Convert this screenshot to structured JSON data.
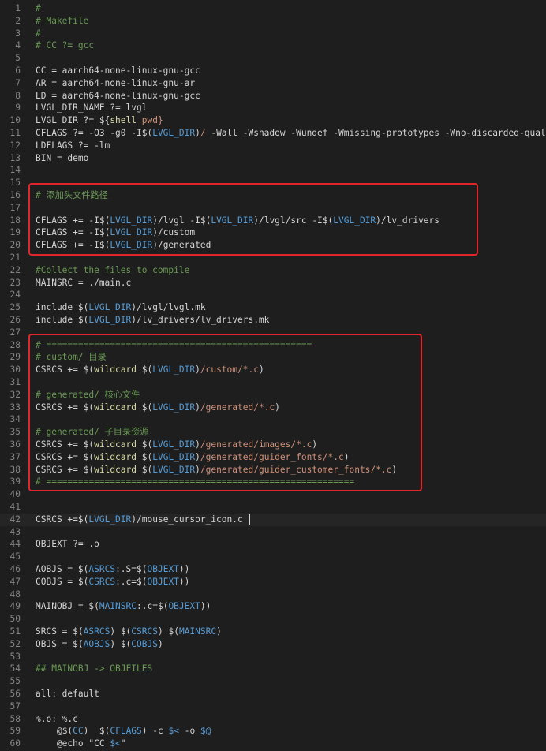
{
  "lines": [
    {
      "n": "1",
      "tokens": [
        {
          "t": "#",
          "c": "comment"
        }
      ]
    },
    {
      "n": "2",
      "tokens": [
        {
          "t": "# Makefile",
          "c": "comment"
        }
      ]
    },
    {
      "n": "3",
      "tokens": [
        {
          "t": "#",
          "c": "comment"
        }
      ]
    },
    {
      "n": "4",
      "tokens": [
        {
          "t": "# CC ?= gcc",
          "c": "comment"
        }
      ]
    },
    {
      "n": "5",
      "tokens": []
    },
    {
      "n": "6",
      "tokens": [
        {
          "t": "CC = aarch64-none-linux-gnu-gcc",
          "c": "plain"
        }
      ]
    },
    {
      "n": "7",
      "tokens": [
        {
          "t": "AR = aarch64-none-linux-gnu-ar",
          "c": "plain"
        }
      ]
    },
    {
      "n": "8",
      "tokens": [
        {
          "t": "LD = aarch64-none-linux-gnu-gcc",
          "c": "plain"
        }
      ]
    },
    {
      "n": "9",
      "tokens": [
        {
          "t": "LVGL_DIR_NAME ?= lvgl",
          "c": "plain"
        }
      ]
    },
    {
      "n": "10",
      "tokens": [
        {
          "t": "LVGL_DIR ?= ",
          "c": "plain"
        },
        {
          "t": "${",
          "c": "op"
        },
        {
          "t": "shell",
          "c": "fn"
        },
        {
          "t": " pwd}",
          "c": "str"
        }
      ]
    },
    {
      "n": "11",
      "tokens": [
        {
          "t": "CFLAGS ?= -O3 -g0 -I",
          "c": "plain"
        },
        {
          "t": "$(",
          "c": "op"
        },
        {
          "t": "LVGL_DIR",
          "c": "var"
        },
        {
          "t": ")",
          "c": "op"
        },
        {
          "t": "/",
          "c": "str"
        },
        {
          "t": " -Wall -Wshadow -Wundef -Wmissing-prototypes -Wno-discarded-qualifiers",
          "c": "plain"
        }
      ]
    },
    {
      "n": "12",
      "tokens": [
        {
          "t": "LDFLAGS ?= -lm",
          "c": "plain"
        }
      ]
    },
    {
      "n": "13",
      "tokens": [
        {
          "t": "BIN = demo",
          "c": "plain"
        }
      ]
    },
    {
      "n": "14",
      "tokens": []
    },
    {
      "n": "15",
      "tokens": []
    },
    {
      "n": "16",
      "tokens": [
        {
          "t": "# 添加头文件路径",
          "c": "comment"
        }
      ]
    },
    {
      "n": "17",
      "tokens": []
    },
    {
      "n": "18",
      "tokens": [
        {
          "t": "CFLAGS += -I",
          "c": "plain"
        },
        {
          "t": "$(",
          "c": "op"
        },
        {
          "t": "LVGL_DIR",
          "c": "var"
        },
        {
          "t": ")",
          "c": "op"
        },
        {
          "t": "/lvgl -I",
          "c": "plain"
        },
        {
          "t": "$(",
          "c": "op"
        },
        {
          "t": "LVGL_DIR",
          "c": "var"
        },
        {
          "t": ")",
          "c": "op"
        },
        {
          "t": "/lvgl/src -I",
          "c": "plain"
        },
        {
          "t": "$(",
          "c": "op"
        },
        {
          "t": "LVGL_DIR",
          "c": "var"
        },
        {
          "t": ")",
          "c": "op"
        },
        {
          "t": "/lv_drivers",
          "c": "plain"
        }
      ]
    },
    {
      "n": "19",
      "tokens": [
        {
          "t": "CFLAGS += -I",
          "c": "plain"
        },
        {
          "t": "$(",
          "c": "op"
        },
        {
          "t": "LVGL_DIR",
          "c": "var"
        },
        {
          "t": ")",
          "c": "op"
        },
        {
          "t": "/custom",
          "c": "plain"
        }
      ]
    },
    {
      "n": "20",
      "tokens": [
        {
          "t": "CFLAGS += -I",
          "c": "plain"
        },
        {
          "t": "$(",
          "c": "op"
        },
        {
          "t": "LVGL_DIR",
          "c": "var"
        },
        {
          "t": ")",
          "c": "op"
        },
        {
          "t": "/generated",
          "c": "plain"
        }
      ]
    },
    {
      "n": "21",
      "tokens": []
    },
    {
      "n": "22",
      "tokens": [
        {
          "t": "#Collect the files to compile",
          "c": "comment"
        }
      ]
    },
    {
      "n": "23",
      "tokens": [
        {
          "t": "MAINSRC = ./main.c",
          "c": "plain"
        }
      ]
    },
    {
      "n": "24",
      "tokens": []
    },
    {
      "n": "25",
      "tokens": [
        {
          "t": "include ",
          "c": "plain"
        },
        {
          "t": "$(",
          "c": "op"
        },
        {
          "t": "LVGL_DIR",
          "c": "var"
        },
        {
          "t": ")",
          "c": "op"
        },
        {
          "t": "/lvgl/lvgl.mk",
          "c": "plain"
        }
      ]
    },
    {
      "n": "26",
      "tokens": [
        {
          "t": "include ",
          "c": "plain"
        },
        {
          "t": "$(",
          "c": "op"
        },
        {
          "t": "LVGL_DIR",
          "c": "var"
        },
        {
          "t": ")",
          "c": "op"
        },
        {
          "t": "/lv_drivers/lv_drivers.mk",
          "c": "plain"
        }
      ]
    },
    {
      "n": "27",
      "tokens": []
    },
    {
      "n": "28",
      "tokens": [
        {
          "t": "# ==================================================",
          "c": "comment"
        }
      ]
    },
    {
      "n": "29",
      "tokens": [
        {
          "t": "# custom/ 目录",
          "c": "comment"
        }
      ]
    },
    {
      "n": "30",
      "tokens": [
        {
          "t": "CSRCS += ",
          "c": "plain"
        },
        {
          "t": "$(",
          "c": "op"
        },
        {
          "t": "wildcard",
          "c": "fn"
        },
        {
          "t": " ",
          "c": "plain"
        },
        {
          "t": "$(",
          "c": "op"
        },
        {
          "t": "LVGL_DIR",
          "c": "var"
        },
        {
          "t": ")",
          "c": "op"
        },
        {
          "t": "/custom/*.c",
          "c": "str"
        },
        {
          "t": ")",
          "c": "op"
        }
      ]
    },
    {
      "n": "31",
      "tokens": []
    },
    {
      "n": "32",
      "tokens": [
        {
          "t": "# generated/ 核心文件",
          "c": "comment"
        }
      ]
    },
    {
      "n": "33",
      "tokens": [
        {
          "t": "CSRCS += ",
          "c": "plain"
        },
        {
          "t": "$(",
          "c": "op"
        },
        {
          "t": "wildcard",
          "c": "fn"
        },
        {
          "t": " ",
          "c": "plain"
        },
        {
          "t": "$(",
          "c": "op"
        },
        {
          "t": "LVGL_DIR",
          "c": "var"
        },
        {
          "t": ")",
          "c": "op"
        },
        {
          "t": "/generated/*.c",
          "c": "str"
        },
        {
          "t": ")",
          "c": "op"
        }
      ]
    },
    {
      "n": "34",
      "tokens": []
    },
    {
      "n": "35",
      "tokens": [
        {
          "t": "# generated/ 子目录资源",
          "c": "comment"
        }
      ]
    },
    {
      "n": "36",
      "tokens": [
        {
          "t": "CSRCS += ",
          "c": "plain"
        },
        {
          "t": "$(",
          "c": "op"
        },
        {
          "t": "wildcard",
          "c": "fn"
        },
        {
          "t": " ",
          "c": "plain"
        },
        {
          "t": "$(",
          "c": "op"
        },
        {
          "t": "LVGL_DIR",
          "c": "var"
        },
        {
          "t": ")",
          "c": "op"
        },
        {
          "t": "/generated/images/*.c",
          "c": "str"
        },
        {
          "t": ")",
          "c": "op"
        }
      ]
    },
    {
      "n": "37",
      "tokens": [
        {
          "t": "CSRCS += ",
          "c": "plain"
        },
        {
          "t": "$(",
          "c": "op"
        },
        {
          "t": "wildcard",
          "c": "fn"
        },
        {
          "t": " ",
          "c": "plain"
        },
        {
          "t": "$(",
          "c": "op"
        },
        {
          "t": "LVGL_DIR",
          "c": "var"
        },
        {
          "t": ")",
          "c": "op"
        },
        {
          "t": "/generated/guider_fonts/*.c",
          "c": "str"
        },
        {
          "t": ")",
          "c": "op"
        }
      ]
    },
    {
      "n": "38",
      "tokens": [
        {
          "t": "CSRCS += ",
          "c": "plain"
        },
        {
          "t": "$(",
          "c": "op"
        },
        {
          "t": "wildcard",
          "c": "fn"
        },
        {
          "t": " ",
          "c": "plain"
        },
        {
          "t": "$(",
          "c": "op"
        },
        {
          "t": "LVGL_DIR",
          "c": "var"
        },
        {
          "t": ")",
          "c": "op"
        },
        {
          "t": "/generated/guider_customer_fonts/*.c",
          "c": "str"
        },
        {
          "t": ")",
          "c": "op"
        }
      ]
    },
    {
      "n": "39",
      "tokens": [
        {
          "t": "# ==========================================================",
          "c": "comment"
        }
      ]
    },
    {
      "n": "40",
      "tokens": []
    },
    {
      "n": "41",
      "tokens": []
    },
    {
      "n": "42",
      "tokens": [
        {
          "t": "CSRCS +=",
          "c": "plain"
        },
        {
          "t": "$(",
          "c": "op"
        },
        {
          "t": "LVGL_DIR",
          "c": "var"
        },
        {
          "t": ")",
          "c": "op"
        },
        {
          "t": "/mouse_cursor_icon.c ",
          "c": "plain"
        }
      ],
      "caret": true,
      "current": true
    },
    {
      "n": "43",
      "tokens": []
    },
    {
      "n": "44",
      "tokens": [
        {
          "t": "OBJEXT ?= .o",
          "c": "plain"
        }
      ]
    },
    {
      "n": "45",
      "tokens": []
    },
    {
      "n": "46",
      "tokens": [
        {
          "t": "AOBJS = ",
          "c": "plain"
        },
        {
          "t": "$(",
          "c": "op"
        },
        {
          "t": "ASRCS",
          "c": "var"
        },
        {
          "t": ":.S=",
          "c": "plain"
        },
        {
          "t": "$(",
          "c": "op"
        },
        {
          "t": "OBJEXT",
          "c": "var"
        },
        {
          "t": "))",
          "c": "op"
        }
      ]
    },
    {
      "n": "47",
      "tokens": [
        {
          "t": "COBJS = ",
          "c": "plain"
        },
        {
          "t": "$(",
          "c": "op"
        },
        {
          "t": "CSRCS",
          "c": "var"
        },
        {
          "t": ":.c=",
          "c": "plain"
        },
        {
          "t": "$(",
          "c": "op"
        },
        {
          "t": "OBJEXT",
          "c": "var"
        },
        {
          "t": "))",
          "c": "op"
        }
      ]
    },
    {
      "n": "48",
      "tokens": []
    },
    {
      "n": "49",
      "tokens": [
        {
          "t": "MAINOBJ = ",
          "c": "plain"
        },
        {
          "t": "$(",
          "c": "op"
        },
        {
          "t": "MAINSRC",
          "c": "var"
        },
        {
          "t": ":.c=",
          "c": "plain"
        },
        {
          "t": "$(",
          "c": "op"
        },
        {
          "t": "OBJEXT",
          "c": "var"
        },
        {
          "t": "))",
          "c": "op"
        }
      ]
    },
    {
      "n": "50",
      "tokens": []
    },
    {
      "n": "51",
      "tokens": [
        {
          "t": "SRCS = ",
          "c": "plain"
        },
        {
          "t": "$(",
          "c": "op"
        },
        {
          "t": "ASRCS",
          "c": "var"
        },
        {
          "t": ") ",
          "c": "op"
        },
        {
          "t": "$(",
          "c": "op"
        },
        {
          "t": "CSRCS",
          "c": "var"
        },
        {
          "t": ") ",
          "c": "op"
        },
        {
          "t": "$(",
          "c": "op"
        },
        {
          "t": "MAINSRC",
          "c": "var"
        },
        {
          "t": ")",
          "c": "op"
        }
      ]
    },
    {
      "n": "52",
      "tokens": [
        {
          "t": "OBJS = ",
          "c": "plain"
        },
        {
          "t": "$(",
          "c": "op"
        },
        {
          "t": "AOBJS",
          "c": "var"
        },
        {
          "t": ") ",
          "c": "op"
        },
        {
          "t": "$(",
          "c": "op"
        },
        {
          "t": "COBJS",
          "c": "var"
        },
        {
          "t": ")",
          "c": "op"
        }
      ]
    },
    {
      "n": "53",
      "tokens": []
    },
    {
      "n": "54",
      "tokens": [
        {
          "t": "## MAINOBJ -> OBJFILES",
          "c": "comment"
        }
      ]
    },
    {
      "n": "55",
      "tokens": []
    },
    {
      "n": "56",
      "tokens": [
        {
          "t": "all: default",
          "c": "target"
        }
      ]
    },
    {
      "n": "57",
      "tokens": []
    },
    {
      "n": "58",
      "tokens": [
        {
          "t": "%.o: %.c",
          "c": "target"
        }
      ]
    },
    {
      "n": "59",
      "tokens": [
        {
          "t": "    @",
          "c": "plain"
        },
        {
          "t": "$(",
          "c": "op"
        },
        {
          "t": "CC",
          "c": "var"
        },
        {
          "t": ")  ",
          "c": "op"
        },
        {
          "t": "$(",
          "c": "op"
        },
        {
          "t": "CFLAGS",
          "c": "var"
        },
        {
          "t": ") ",
          "c": "op"
        },
        {
          "t": "-c ",
          "c": "plain"
        },
        {
          "t": "$<",
          "c": "var"
        },
        {
          "t": " -o ",
          "c": "plain"
        },
        {
          "t": "$@",
          "c": "var"
        }
      ]
    },
    {
      "n": "60",
      "tokens": [
        {
          "t": "    @echo ",
          "c": "plain"
        },
        {
          "t": "\"CC ",
          "c": "plain"
        },
        {
          "t": "$<",
          "c": "var"
        },
        {
          "t": "\"",
          "c": "plain"
        }
      ]
    }
  ],
  "colors": {
    "background": "#1e1e1e",
    "highlight_box": "#e0262a",
    "comment": "#6a9955",
    "variable": "#569cd6",
    "function": "#dcdcaa",
    "string": "#ce9178"
  }
}
